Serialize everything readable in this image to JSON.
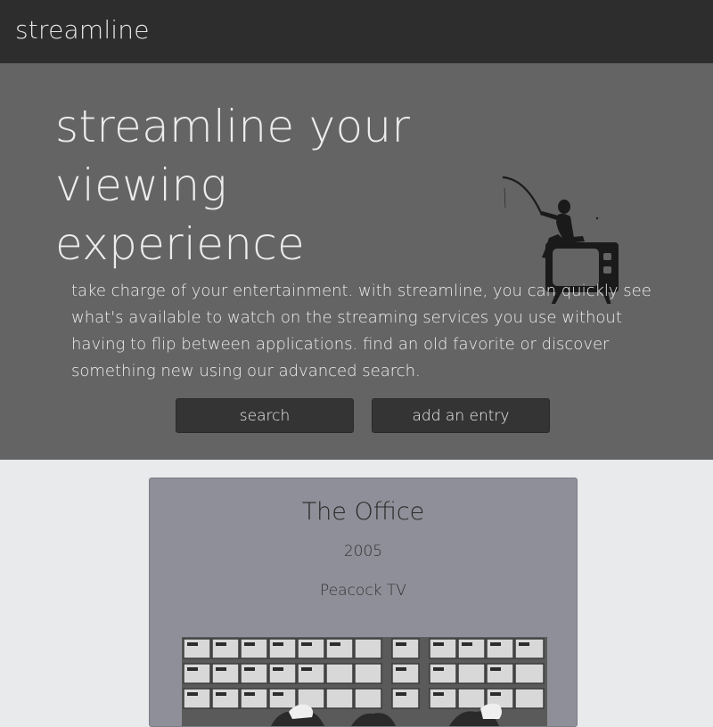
{
  "navbar": {
    "brand": "streamline"
  },
  "hero": {
    "title": "streamline your viewing experience",
    "description": "take charge of your entertainment. with streamline, you can quickly see what's available to watch on the streaming services you use without having to flip between applications. find an old favorite or discover something new using our advanced search.",
    "illustration_icon": "fisherman-on-tv-illustration",
    "buttons": {
      "search_label": "search",
      "add_label": "add an entry"
    }
  },
  "card": {
    "title": "The Office",
    "year": "2005",
    "service": "Peacock TV",
    "image_alt": "The Office promotional image"
  },
  "colors": {
    "navbar": "#2d2d2d",
    "hero": "#646464",
    "button": "#343434",
    "page_bg": "#e9eaec",
    "card_bg": "#8e8f98"
  }
}
